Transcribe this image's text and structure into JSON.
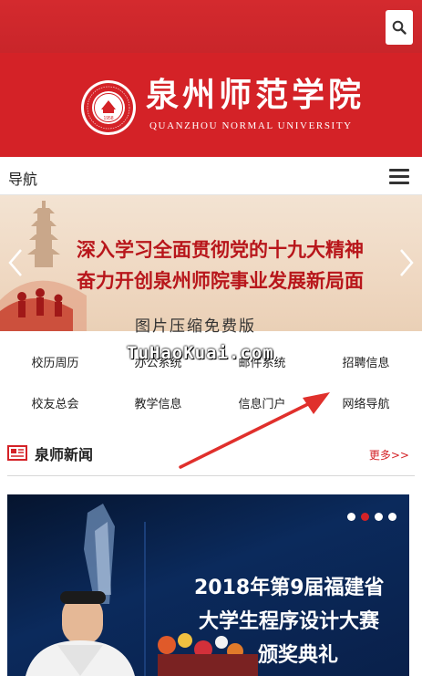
{
  "header": {
    "search_icon": "search-icon",
    "brand_cn": "泉州师范学院",
    "brand_en": "QUANZHOU NORMAL UNIVERSITY",
    "seal_year": "1958",
    "brand_color": "#d42227"
  },
  "nav": {
    "title": "导航",
    "menu_icon": "hamburger-icon"
  },
  "banner": {
    "line1": "深入学习全面贯彻党的十九大精神",
    "line2": "奋力开创泉州师院事业发展新局面"
  },
  "watermark": {
    "line1": "图片压缩免费版",
    "line2": "TuHaoKuai.com"
  },
  "quick_links": [
    "校历周历",
    "办公系统",
    "邮件系统",
    "招聘信息",
    "校友总会",
    "教学信息",
    "信息门户",
    "网络导航"
  ],
  "news": {
    "title": "泉师新闻",
    "more": "更多>>",
    "slide_line1": "2018年第9届福建省",
    "slide_line2": "大学生程序设计大赛",
    "slide_line3": "颁奖典礼",
    "slide_count": 4,
    "active_slide": 2
  }
}
